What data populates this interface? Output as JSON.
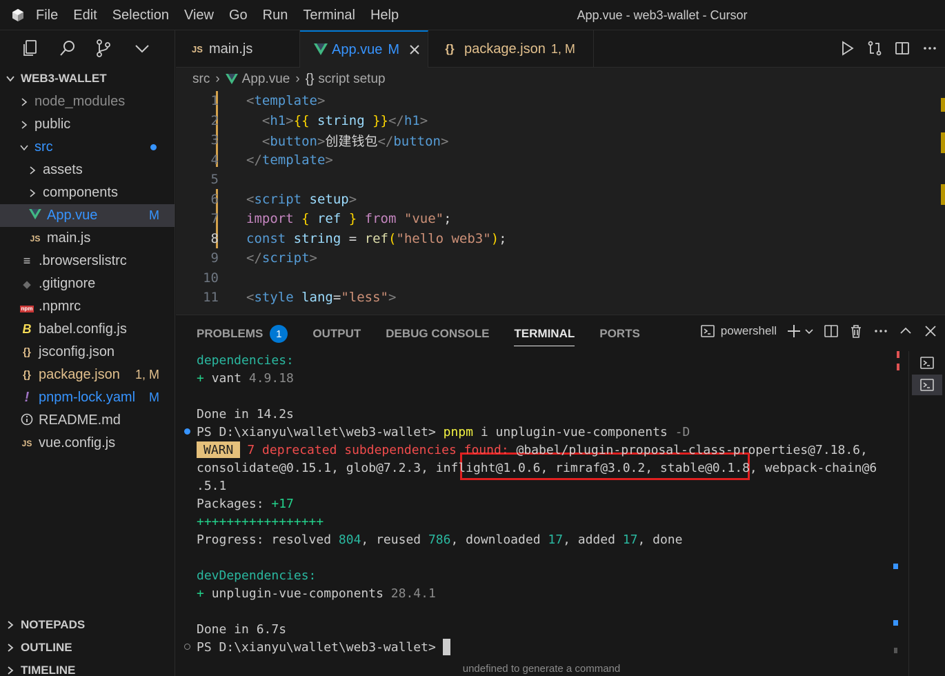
{
  "window": {
    "title": "App.vue - web3-wallet - Cursor"
  },
  "menu": [
    "File",
    "Edit",
    "Selection",
    "View",
    "Go",
    "Run",
    "Terminal",
    "Help"
  ],
  "sidebar": {
    "project": "WEB3-WALLET",
    "items": [
      {
        "label": "node_modules",
        "kind": "folder",
        "indent": 1,
        "color": "#8b8b8b"
      },
      {
        "label": "public",
        "kind": "folder",
        "indent": 1,
        "color": "#cccccc"
      },
      {
        "label": "src",
        "kind": "folder-open",
        "indent": 1,
        "color": "#3794ff",
        "dot": true
      },
      {
        "label": "assets",
        "kind": "folder",
        "indent": 2,
        "color": "#cccccc"
      },
      {
        "label": "components",
        "kind": "folder",
        "indent": 2,
        "color": "#cccccc"
      },
      {
        "label": "App.vue",
        "kind": "vue",
        "indent": 2,
        "color": "#3794ff",
        "badge": "M",
        "selected": true
      },
      {
        "label": "main.js",
        "kind": "js",
        "indent": 2,
        "color": "#cccccc"
      },
      {
        "label": ".browserslistrc",
        "kind": "lines",
        "indent": 1,
        "color": "#cccccc"
      },
      {
        "label": ".gitignore",
        "kind": "git",
        "indent": 1,
        "color": "#cccccc"
      },
      {
        "label": ".npmrc",
        "kind": "npm",
        "indent": 1,
        "color": "#cccccc"
      },
      {
        "label": "babel.config.js",
        "kind": "babel",
        "indent": 1,
        "color": "#cccccc"
      },
      {
        "label": "jsconfig.json",
        "kind": "json",
        "indent": 1,
        "color": "#cccccc"
      },
      {
        "label": "package.json",
        "kind": "json",
        "indent": 1,
        "color": "#e2c08d",
        "badge": "1, M"
      },
      {
        "label": "pnpm-lock.yaml",
        "kind": "yaml",
        "indent": 1,
        "color": "#3794ff",
        "badge": "M"
      },
      {
        "label": "README.md",
        "kind": "info",
        "indent": 1,
        "color": "#cccccc"
      },
      {
        "label": "vue.config.js",
        "kind": "js",
        "indent": 1,
        "color": "#cccccc"
      }
    ],
    "sections": [
      "NOTEPADS",
      "OUTLINE",
      "TIMELINE"
    ]
  },
  "tabs": [
    {
      "label": "main.js",
      "icon": "JS",
      "color": "#cccccc"
    },
    {
      "label": "App.vue",
      "suffix": "M",
      "icon": "vue",
      "color": "#3794ff",
      "active": true
    },
    {
      "label": "package.json",
      "suffix": "1, M",
      "icon": "{}",
      "color": "#e2c08d"
    }
  ],
  "breadcrumb": [
    "src",
    "App.vue",
    "script setup"
  ],
  "editor": {
    "current_line": 8,
    "lines": [
      {
        "n": "1",
        "tokens": [
          [
            "t-punc",
            "<"
          ],
          [
            "t-tag",
            "template"
          ],
          [
            "t-punc",
            ">"
          ]
        ]
      },
      {
        "n": "2",
        "tokens": [
          [
            "t-txt",
            "  "
          ],
          [
            "t-punc",
            "<"
          ],
          [
            "t-tag",
            "h1"
          ],
          [
            "t-punc",
            ">"
          ],
          [
            "t-brace",
            "{{"
          ],
          [
            "t-var",
            " string "
          ],
          [
            "t-brace",
            "}}"
          ],
          [
            "t-punc",
            "</"
          ],
          [
            "t-tag",
            "h1"
          ],
          [
            "t-punc",
            ">"
          ]
        ]
      },
      {
        "n": "3",
        "tokens": [
          [
            "t-txt",
            "  "
          ],
          [
            "t-punc",
            "<"
          ],
          [
            "t-tag",
            "button"
          ],
          [
            "t-punc",
            ">"
          ],
          [
            "t-txt",
            "创建钱包"
          ],
          [
            "t-punc",
            "</"
          ],
          [
            "t-tag",
            "button"
          ],
          [
            "t-punc",
            ">"
          ]
        ]
      },
      {
        "n": "4",
        "tokens": [
          [
            "t-punc",
            "</"
          ],
          [
            "t-tag",
            "template"
          ],
          [
            "t-punc",
            ">"
          ]
        ]
      },
      {
        "n": "5",
        "tokens": []
      },
      {
        "n": "6",
        "tokens": [
          [
            "t-punc",
            "<"
          ],
          [
            "t-tag",
            "script"
          ],
          [
            "t-attr",
            " setup"
          ],
          [
            "t-punc",
            ">"
          ]
        ]
      },
      {
        "n": "7",
        "tokens": [
          [
            "t-imp",
            "import"
          ],
          [
            "t-txt",
            " "
          ],
          [
            "t-brace",
            "{"
          ],
          [
            "t-var",
            " ref "
          ],
          [
            "t-brace",
            "}"
          ],
          [
            "t-txt",
            " "
          ],
          [
            "t-imp",
            "from"
          ],
          [
            "t-txt",
            " "
          ],
          [
            "t-str",
            "\"vue\""
          ],
          [
            "t-txt",
            ";"
          ]
        ]
      },
      {
        "n": "8",
        "tokens": [
          [
            "t-kw",
            "const"
          ],
          [
            "t-txt",
            " "
          ],
          [
            "t-var",
            "string"
          ],
          [
            "t-txt",
            " = "
          ],
          [
            "t-fn",
            "ref"
          ],
          [
            "t-brace",
            "("
          ],
          [
            "t-str",
            "\"hello web3\""
          ],
          [
            "t-brace",
            ")"
          ],
          [
            "t-txt",
            ";"
          ]
        ]
      },
      {
        "n": "9",
        "tokens": [
          [
            "t-punc",
            "</"
          ],
          [
            "t-tag",
            "script"
          ],
          [
            "t-punc",
            ">"
          ]
        ]
      },
      {
        "n": "10",
        "tokens": []
      },
      {
        "n": "11",
        "tokens": [
          [
            "t-punc",
            "<"
          ],
          [
            "t-tag",
            "style"
          ],
          [
            "t-attr",
            " lang"
          ],
          [
            "t-txt",
            "="
          ],
          [
            "t-str",
            "\"less\""
          ],
          [
            "t-punc",
            ">"
          ]
        ]
      }
    ]
  },
  "panel": {
    "tabs": [
      "PROBLEMS",
      "OUTPUT",
      "DEBUG CONSOLE",
      "TERMINAL",
      "PORTS"
    ],
    "problems_count": "1",
    "active_tab": "TERMINAL",
    "shell": "powershell",
    "hint": "undefined to generate a command"
  },
  "terminal": [
    {
      "segs": [
        [
          "c-cyan",
          "dependencies:"
        ]
      ]
    },
    {
      "segs": [
        [
          "c-green",
          "+ "
        ],
        [
          "",
          "vant "
        ],
        [
          "c-dim",
          "4.9.18"
        ]
      ]
    },
    {
      "segs": []
    },
    {
      "segs": [
        [
          "",
          "Done in 14.2s"
        ]
      ]
    },
    {
      "dot": "#3794ff",
      "segs": [
        [
          "",
          "PS D:\\xianyu\\wallet\\web3-wallet> "
        ],
        [
          "c-yellow",
          "pnpm"
        ],
        [
          "",
          " i unplugin-vue-components "
        ],
        [
          "c-dim",
          "-D"
        ]
      ]
    },
    {
      "warn": "WARN",
      "segs": [
        [
          "c-red",
          "7 deprecated subdependencies found: "
        ],
        [
          "",
          "@babel/plugin-proposal-class-properties@7.18.6,"
        ]
      ]
    },
    {
      "segs": [
        [
          "",
          "consolidate@0.15.1, glob@7.2.3, inflight@1.0.6, rimraf@3.0.2, stable@0.1.8, webpack-chain@6"
        ]
      ]
    },
    {
      "segs": [
        [
          "",
          ".5.1"
        ]
      ]
    },
    {
      "segs": [
        [
          "",
          "Packages: "
        ],
        [
          "c-green",
          "+17"
        ]
      ]
    },
    {
      "segs": [
        [
          "c-green",
          "+++++++++++++++++"
        ]
      ]
    },
    {
      "segs": [
        [
          "",
          "Progress: resolved "
        ],
        [
          "c-num",
          "804"
        ],
        [
          "",
          ", reused "
        ],
        [
          "c-num",
          "786"
        ],
        [
          "",
          ", downloaded "
        ],
        [
          "c-num",
          "17"
        ],
        [
          "",
          ", added "
        ],
        [
          "c-num",
          "17"
        ],
        [
          "",
          ", done"
        ]
      ]
    },
    {
      "segs": []
    },
    {
      "segs": [
        [
          "c-cyan",
          "devDependencies:"
        ]
      ]
    },
    {
      "segs": [
        [
          "c-green",
          "+ "
        ],
        [
          "",
          "unplugin-vue-components "
        ],
        [
          "c-dim",
          "28.4.1"
        ]
      ]
    },
    {
      "segs": []
    },
    {
      "segs": [
        [
          "",
          "Done in 6.7s"
        ]
      ]
    },
    {
      "dot": "ring",
      "cursor": true,
      "segs": [
        [
          "",
          "PS D:\\xianyu\\wallet\\web3-wallet>"
        ]
      ]
    }
  ]
}
